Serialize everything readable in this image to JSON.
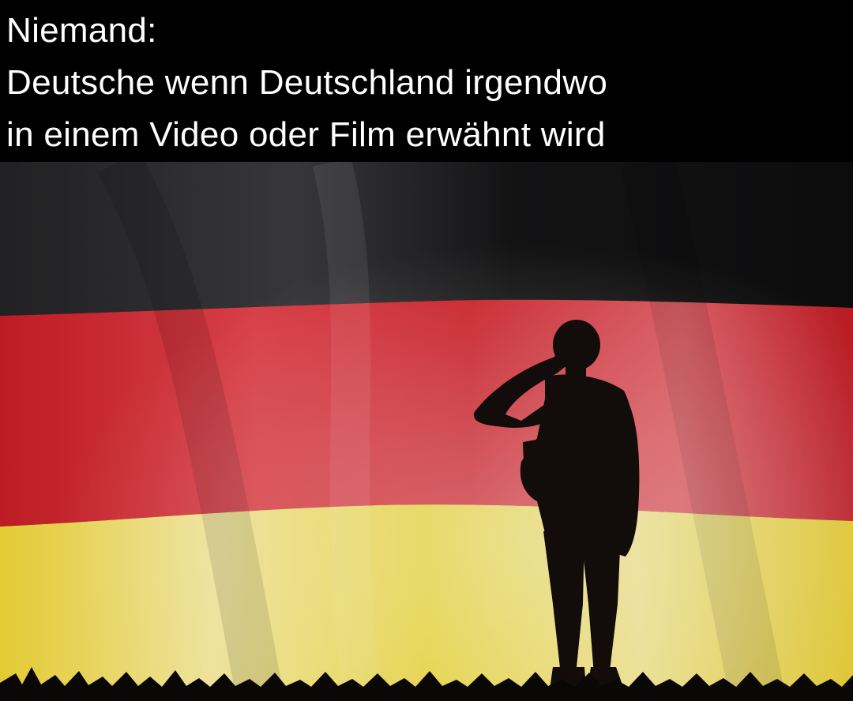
{
  "caption": {
    "line1": "Niemand:",
    "line2": "Deutsche wenn Deutschland irgendwo",
    "line3": "in einem Video oder Film erwähnt wird"
  },
  "image": {
    "subject": "soldier-silhouette-saluting",
    "background": "german-flag",
    "flag_colors": {
      "top": "#1c1c1c",
      "middle": "#d9232b",
      "bottom": "#f2dc3a"
    }
  }
}
